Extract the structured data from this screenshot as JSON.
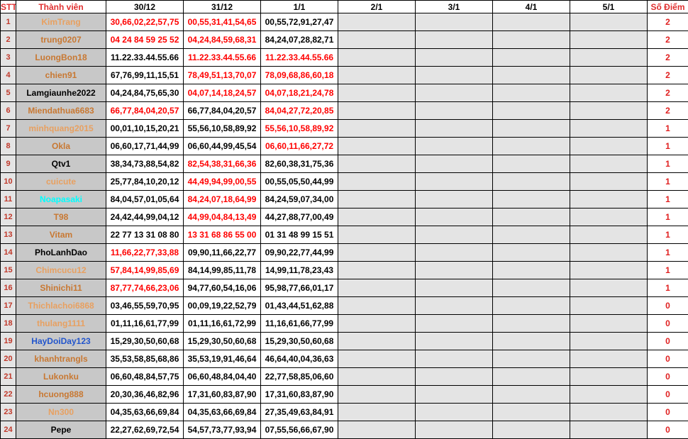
{
  "header": {
    "stt": "STT",
    "name": "Thành viên",
    "dates": [
      "30/12",
      "31/12",
      "1/1",
      "2/1",
      "3/1",
      "4/1",
      "5/1"
    ],
    "score": "Số Điểm"
  },
  "colors": {
    "orange_name": "#c87832",
    "light_orange_name": "#e8a060",
    "black_name": "#000000",
    "cyan_name": "#00ffff",
    "blue_name": "#2255cc",
    "red_value": "#ff0000",
    "black_value": "#000000",
    "score": "#e02020"
  },
  "rows": [
    {
      "stt": "1",
      "name": "KimTrang",
      "name_color": "#e8a060",
      "cells": [
        {
          "text": "30,66,02,22,57,75",
          "color": "#ff0000"
        },
        {
          "text": "00,55,31,41,54,65",
          "color": "#ff0000"
        },
        {
          "text": "00,55,72,91,27,47",
          "color": "#000000"
        }
      ],
      "score": "2"
    },
    {
      "stt": "2",
      "name": "trung0207",
      "name_color": "#c87832",
      "cells": [
        {
          "text": "04 24 84 59 25 52",
          "color": "#ff0000"
        },
        {
          "text": "04,24,84,59,68,31",
          "color": "#ff0000"
        },
        {
          "text": "84,24,07,28,82,71",
          "color": "#000000"
        }
      ],
      "score": "2"
    },
    {
      "stt": "3",
      "name": "LuongBon18",
      "name_color": "#c87832",
      "cells": [
        {
          "text": "11.22.33.44.55.66",
          "color": "#000000"
        },
        {
          "text": "11.22.33.44.55.66",
          "color": "#ff0000"
        },
        {
          "text": "11.22.33.44.55.66",
          "color": "#ff0000"
        }
      ],
      "score": "2"
    },
    {
      "stt": "4",
      "name": "chien91",
      "name_color": "#c87832",
      "cells": [
        {
          "text": "67,76,99,11,15,51",
          "color": "#000000"
        },
        {
          "text": "78,49,51,13,70,07",
          "color": "#ff0000"
        },
        {
          "text": "78,09,68,86,60,18",
          "color": "#ff0000"
        }
      ],
      "score": "2"
    },
    {
      "stt": "5",
      "name": "Lamgiaunhe2022",
      "name_color": "#000000",
      "cells": [
        {
          "text": "04,24,84,75,65,30",
          "color": "#000000"
        },
        {
          "text": "04,07,14,18,24,57",
          "color": "#ff0000"
        },
        {
          "text": "04,07,18,21,24,78",
          "color": "#ff0000"
        }
      ],
      "score": "2"
    },
    {
      "stt": "6",
      "name": "Miendathua6683",
      "name_color": "#c87832",
      "cells": [
        {
          "text": "66,77,84,04,20,57",
          "color": "#ff0000"
        },
        {
          "text": "66,77,84,04,20,57",
          "color": "#000000"
        },
        {
          "text": "84,04,27,72,20,85",
          "color": "#ff0000"
        }
      ],
      "score": "2"
    },
    {
      "stt": "7",
      "name": "minhquang2015",
      "name_color": "#e8a060",
      "cells": [
        {
          "text": "00,01,10,15,20,21",
          "color": "#000000"
        },
        {
          "text": "55,56,10,58,89,92",
          "color": "#000000"
        },
        {
          "text": "55,56,10,58,89,92",
          "color": "#ff0000"
        }
      ],
      "score": "1"
    },
    {
      "stt": "8",
      "name": "Okla",
      "name_color": "#c87832",
      "cells": [
        {
          "text": "06,60,17,71,44,99",
          "color": "#000000"
        },
        {
          "text": "06,60,44,99,45,54",
          "color": "#000000"
        },
        {
          "text": "06,60,11,66,27,72",
          "color": "#ff0000"
        }
      ],
      "score": "1"
    },
    {
      "stt": "9",
      "name": "Qtv1",
      "name_color": "#000000",
      "cells": [
        {
          "text": "38,34,73,88,54,82",
          "color": "#000000"
        },
        {
          "text": "82,54,38,31,66,36",
          "color": "#ff0000"
        },
        {
          "text": "82,60,38,31,75,36",
          "color": "#000000"
        }
      ],
      "score": "1"
    },
    {
      "stt": "10",
      "name": "cuicute",
      "name_color": "#e8a060",
      "cells": [
        {
          "text": "25,77,84,10,20,12",
          "color": "#000000"
        },
        {
          "text": "44,49,94,99,00,55",
          "color": "#ff0000"
        },
        {
          "text": "00,55,05,50,44,99",
          "color": "#000000"
        }
      ],
      "score": "1"
    },
    {
      "stt": "11",
      "name": "Noapasaki",
      "name_color": "#00ffff",
      "cells": [
        {
          "text": "84,04,57,01,05,64",
          "color": "#000000"
        },
        {
          "text": "84,24,07,18,64,99",
          "color": "#ff0000"
        },
        {
          "text": "84,24,59,07,34,00",
          "color": "#000000"
        }
      ],
      "score": "1"
    },
    {
      "stt": "12",
      "name": "T98",
      "name_color": "#c87832",
      "cells": [
        {
          "text": "24,42,44,99,04,12",
          "color": "#000000"
        },
        {
          "text": "44,99,04,84,13,49",
          "color": "#ff0000"
        },
        {
          "text": "44,27,88,77,00,49",
          "color": "#000000"
        }
      ],
      "score": "1"
    },
    {
      "stt": "13",
      "name": "Vitam",
      "name_color": "#c87832",
      "cells": [
        {
          "text": "22 77 13 31 08 80",
          "color": "#000000"
        },
        {
          "text": "13 31 68 86 55 00",
          "color": "#ff0000"
        },
        {
          "text": "01 31 48 99 15 51",
          "color": "#000000"
        }
      ],
      "score": "1"
    },
    {
      "stt": "14",
      "name": "PhoLanhDao",
      "name_color": "#000000",
      "cells": [
        {
          "text": "11,66,22,77,33,88",
          "color": "#ff0000"
        },
        {
          "text": "09,90,11,66,22,77",
          "color": "#000000"
        },
        {
          "text": "09,90,22,77,44,99",
          "color": "#000000"
        }
      ],
      "score": "1"
    },
    {
      "stt": "15",
      "name": "Chimcucu12",
      "name_color": "#e8a060",
      "cells": [
        {
          "text": "57,84,14,99,85,69",
          "color": "#ff0000"
        },
        {
          "text": "84,14,99,85,11,78",
          "color": "#000000"
        },
        {
          "text": "14,99,11,78,23,43",
          "color": "#000000"
        }
      ],
      "score": "1"
    },
    {
      "stt": "16",
      "name": "Shinichi11",
      "name_color": "#c87832",
      "cells": [
        {
          "text": "87,77,74,66,23,06",
          "color": "#ff0000"
        },
        {
          "text": "94,77,60,54,16,06",
          "color": "#000000"
        },
        {
          "text": "95,98,77,66,01,17",
          "color": "#000000"
        }
      ],
      "score": "1"
    },
    {
      "stt": "17",
      "name": "Thichlachoi6868",
      "name_color": "#e8a060",
      "cells": [
        {
          "text": "03,46,55,59,70,95",
          "color": "#000000"
        },
        {
          "text": "00,09,19,22,52,79",
          "color": "#000000"
        },
        {
          "text": "01,43,44,51,62,88",
          "color": "#000000"
        }
      ],
      "score": "0"
    },
    {
      "stt": "18",
      "name": "thulang1111",
      "name_color": "#e8a060",
      "cells": [
        {
          "text": "01,11,16,61,77,99",
          "color": "#000000"
        },
        {
          "text": "01,11,16,61,72,99",
          "color": "#000000"
        },
        {
          "text": "11,16,61,66,77,99",
          "color": "#000000"
        }
      ],
      "score": "0"
    },
    {
      "stt": "19",
      "name": "HayDoiDay123",
      "name_color": "#2255cc",
      "cells": [
        {
          "text": "15,29,30,50,60,68",
          "color": "#000000"
        },
        {
          "text": "15,29,30,50,60,68",
          "color": "#000000"
        },
        {
          "text": "15,29,30,50,60,68",
          "color": "#000000"
        }
      ],
      "score": "0"
    },
    {
      "stt": "20",
      "name": "khanhtrangls",
      "name_color": "#c87832",
      "cells": [
        {
          "text": "35,53,58,85,68,86",
          "color": "#000000"
        },
        {
          "text": "35,53,19,91,46,64",
          "color": "#000000"
        },
        {
          "text": "46,64,40,04,36,63",
          "color": "#000000"
        }
      ],
      "score": "0"
    },
    {
      "stt": "21",
      "name": "Lukonku",
      "name_color": "#c87832",
      "cells": [
        {
          "text": "06,60,48,84,57,75",
          "color": "#000000"
        },
        {
          "text": "06,60,48,84,04,40",
          "color": "#000000"
        },
        {
          "text": "22,77,58,85,06,60",
          "color": "#000000"
        }
      ],
      "score": "0"
    },
    {
      "stt": "22",
      "name": "hcuong888",
      "name_color": "#c87832",
      "cells": [
        {
          "text": "20,30,36,46,82,96",
          "color": "#000000"
        },
        {
          "text": "17,31,60,83,87,90",
          "color": "#000000"
        },
        {
          "text": "17,31,60,83,87,90",
          "color": "#000000"
        }
      ],
      "score": "0"
    },
    {
      "stt": "23",
      "name": "Nn300",
      "name_color": "#e8a060",
      "cells": [
        {
          "text": "04,35,63,66,69,84",
          "color": "#000000"
        },
        {
          "text": "04,35,63,66,69,84",
          "color": "#000000"
        },
        {
          "text": "27,35,49,63,84,91",
          "color": "#000000"
        }
      ],
      "score": "0"
    },
    {
      "stt": "24",
      "name": "Pepe",
      "name_color": "#000000",
      "cells": [
        {
          "text": "22,27,62,69,72,54",
          "color": "#000000"
        },
        {
          "text": "54,57,73,77,93,94",
          "color": "#000000"
        },
        {
          "text": "07,55,56,66,67,90",
          "color": "#000000"
        }
      ],
      "score": "0"
    }
  ]
}
